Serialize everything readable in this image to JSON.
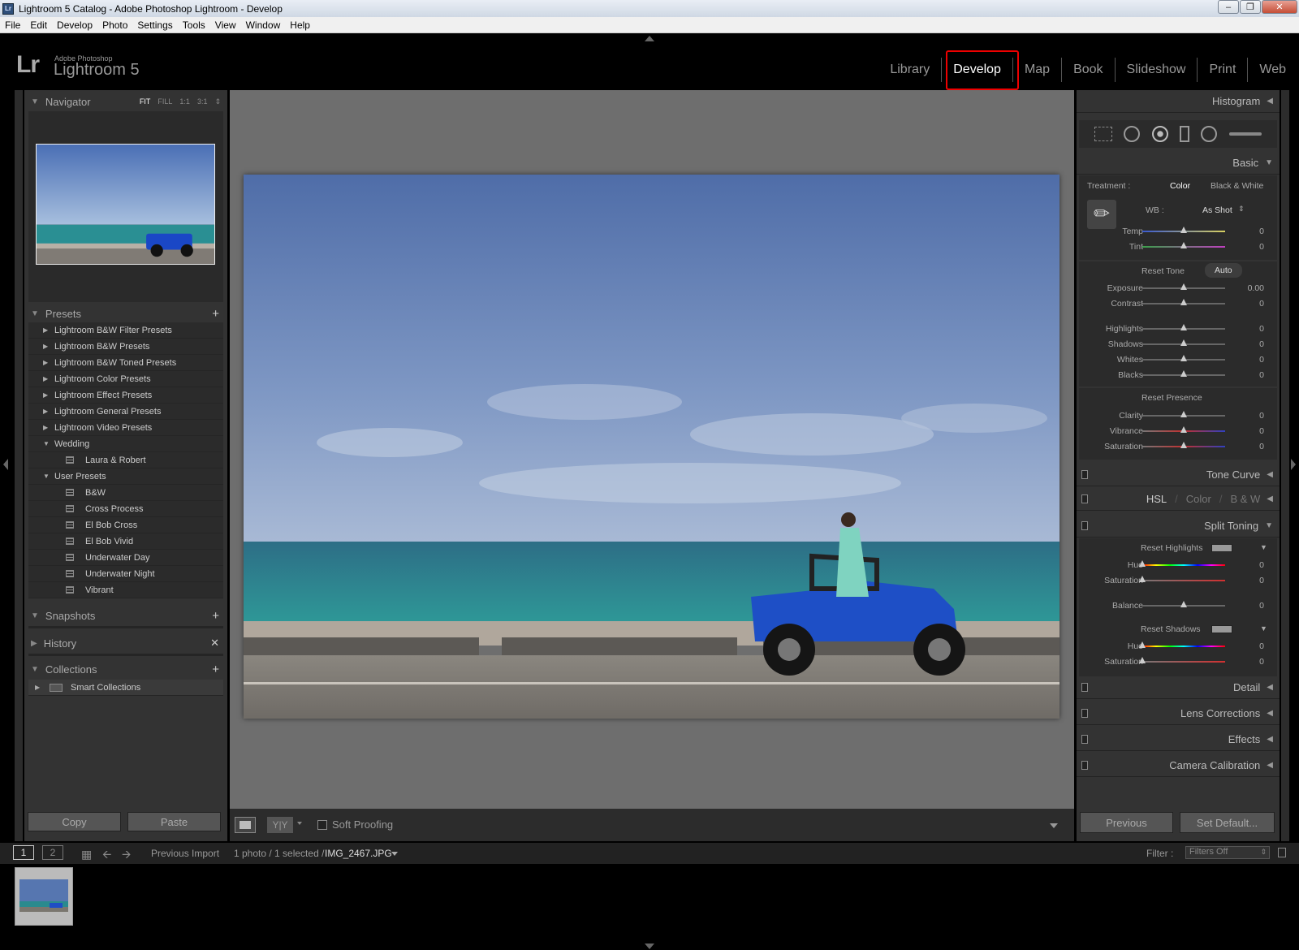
{
  "window": {
    "title": "Lightroom 5 Catalog - Adobe Photoshop Lightroom - Develop",
    "app_icon": "Lr"
  },
  "menubar": [
    "File",
    "Edit",
    "Develop",
    "Photo",
    "Settings",
    "Tools",
    "View",
    "Window",
    "Help"
  ],
  "brand": {
    "logo": "Lr",
    "small": "Adobe Photoshop",
    "big": "Lightroom 5"
  },
  "modules": [
    {
      "label": "Library",
      "active": false
    },
    {
      "label": "Develop",
      "active": true
    },
    {
      "label": "Map",
      "active": false
    },
    {
      "label": "Book",
      "active": false
    },
    {
      "label": "Slideshow",
      "active": false
    },
    {
      "label": "Print",
      "active": false
    },
    {
      "label": "Web",
      "active": false
    }
  ],
  "navigator": {
    "title": "Navigator",
    "options": [
      "FIT",
      "FILL",
      "1:1",
      "3:1"
    ],
    "active_option": "FIT"
  },
  "presets": {
    "title": "Presets",
    "items": [
      {
        "label": "Lightroom B&W Filter Presets",
        "type": "folder",
        "open": false
      },
      {
        "label": "Lightroom B&W Presets",
        "type": "folder",
        "open": false
      },
      {
        "label": "Lightroom B&W Toned Presets",
        "type": "folder",
        "open": false
      },
      {
        "label": "Lightroom Color Presets",
        "type": "folder",
        "open": false
      },
      {
        "label": "Lightroom Effect Presets",
        "type": "folder",
        "open": false
      },
      {
        "label": "Lightroom General Presets",
        "type": "folder",
        "open": false
      },
      {
        "label": "Lightroom Video Presets",
        "type": "folder",
        "open": false
      },
      {
        "label": "Wedding",
        "type": "folder",
        "open": true
      },
      {
        "label": "Laura & Robert",
        "type": "preset"
      },
      {
        "label": "User Presets",
        "type": "folder",
        "open": true
      },
      {
        "label": "B&W",
        "type": "preset"
      },
      {
        "label": "Cross Process",
        "type": "preset"
      },
      {
        "label": "El Bob Cross",
        "type": "preset"
      },
      {
        "label": "El Bob Vivid",
        "type": "preset"
      },
      {
        "label": "Underwater Day",
        "type": "preset"
      },
      {
        "label": "Underwater Night",
        "type": "preset"
      },
      {
        "label": "Vibrant",
        "type": "preset"
      }
    ]
  },
  "snapshots": {
    "title": "Snapshots"
  },
  "history": {
    "title": "History"
  },
  "collections": {
    "title": "Collections",
    "items": [
      "Smart Collections"
    ]
  },
  "left_buttons": {
    "copy": "Copy",
    "paste": "Paste"
  },
  "toolbar": {
    "soft_proofing": "Soft Proofing",
    "compare": "Y|Y"
  },
  "histogram": {
    "title": "Histogram"
  },
  "basic": {
    "title": "Basic",
    "treatment_label": "Treatment :",
    "treatment_options": [
      "Color",
      "Black & White"
    ],
    "wb_label": "WB :",
    "wb_value": "As Shot",
    "reset_tone": "Reset Tone",
    "auto": "Auto",
    "reset_presence": "Reset Presence",
    "sliders": [
      {
        "label": "Temp",
        "value": "0",
        "pos": 0.5
      },
      {
        "label": "Tint",
        "value": "0",
        "pos": 0.5
      },
      {
        "label": "Exposure",
        "value": "0.00",
        "pos": 0.5
      },
      {
        "label": "Contrast",
        "value": "0",
        "pos": 0.5
      },
      {
        "label": "Highlights",
        "value": "0",
        "pos": 0.5
      },
      {
        "label": "Shadows",
        "value": "0",
        "pos": 0.5
      },
      {
        "label": "Whites",
        "value": "0",
        "pos": 0.5
      },
      {
        "label": "Blacks",
        "value": "0",
        "pos": 0.5
      },
      {
        "label": "Clarity",
        "value": "0",
        "pos": 0.5
      },
      {
        "label": "Vibrance",
        "value": "0",
        "pos": 0.5
      },
      {
        "label": "Saturation",
        "value": "0",
        "pos": 0.5
      }
    ]
  },
  "tone_curve": {
    "title": "Tone Curve"
  },
  "hsl": {
    "items": [
      "HSL",
      "/",
      "Color",
      "/",
      "B & W"
    ]
  },
  "split_toning": {
    "title": "Split Toning",
    "reset_highlights": "Reset Highlights",
    "reset_shadows": "Reset Shadows",
    "sliders": [
      {
        "label": "Hue",
        "value": "0",
        "pos": 0.0
      },
      {
        "label": "Saturation",
        "value": "0",
        "pos": 0.0
      },
      {
        "label": "Balance",
        "value": "0",
        "pos": 0.5
      },
      {
        "label": "Hue",
        "value": "0",
        "pos": 0.0
      },
      {
        "label": "Saturation",
        "value": "0",
        "pos": 0.0
      }
    ]
  },
  "detail": {
    "title": "Detail"
  },
  "lens_corrections": {
    "title": "Lens Corrections"
  },
  "effects": {
    "title": "Effects"
  },
  "camera_calibration": {
    "title": "Camera Calibration"
  },
  "right_buttons": {
    "previous": "Previous",
    "set_default": "Set Default..."
  },
  "filmstrip": {
    "screen1": "1",
    "screen2": "2",
    "source": "Previous Import",
    "count": "1 photo / 1 selected /",
    "filename": "IMG_2467.JPG",
    "filter_label": "Filter :",
    "filter_value": "Filters Off"
  },
  "colors": {
    "accent_highlight": "#e00000",
    "panel_bg": "#333333",
    "workspace_bg": "#6e6e6e"
  }
}
